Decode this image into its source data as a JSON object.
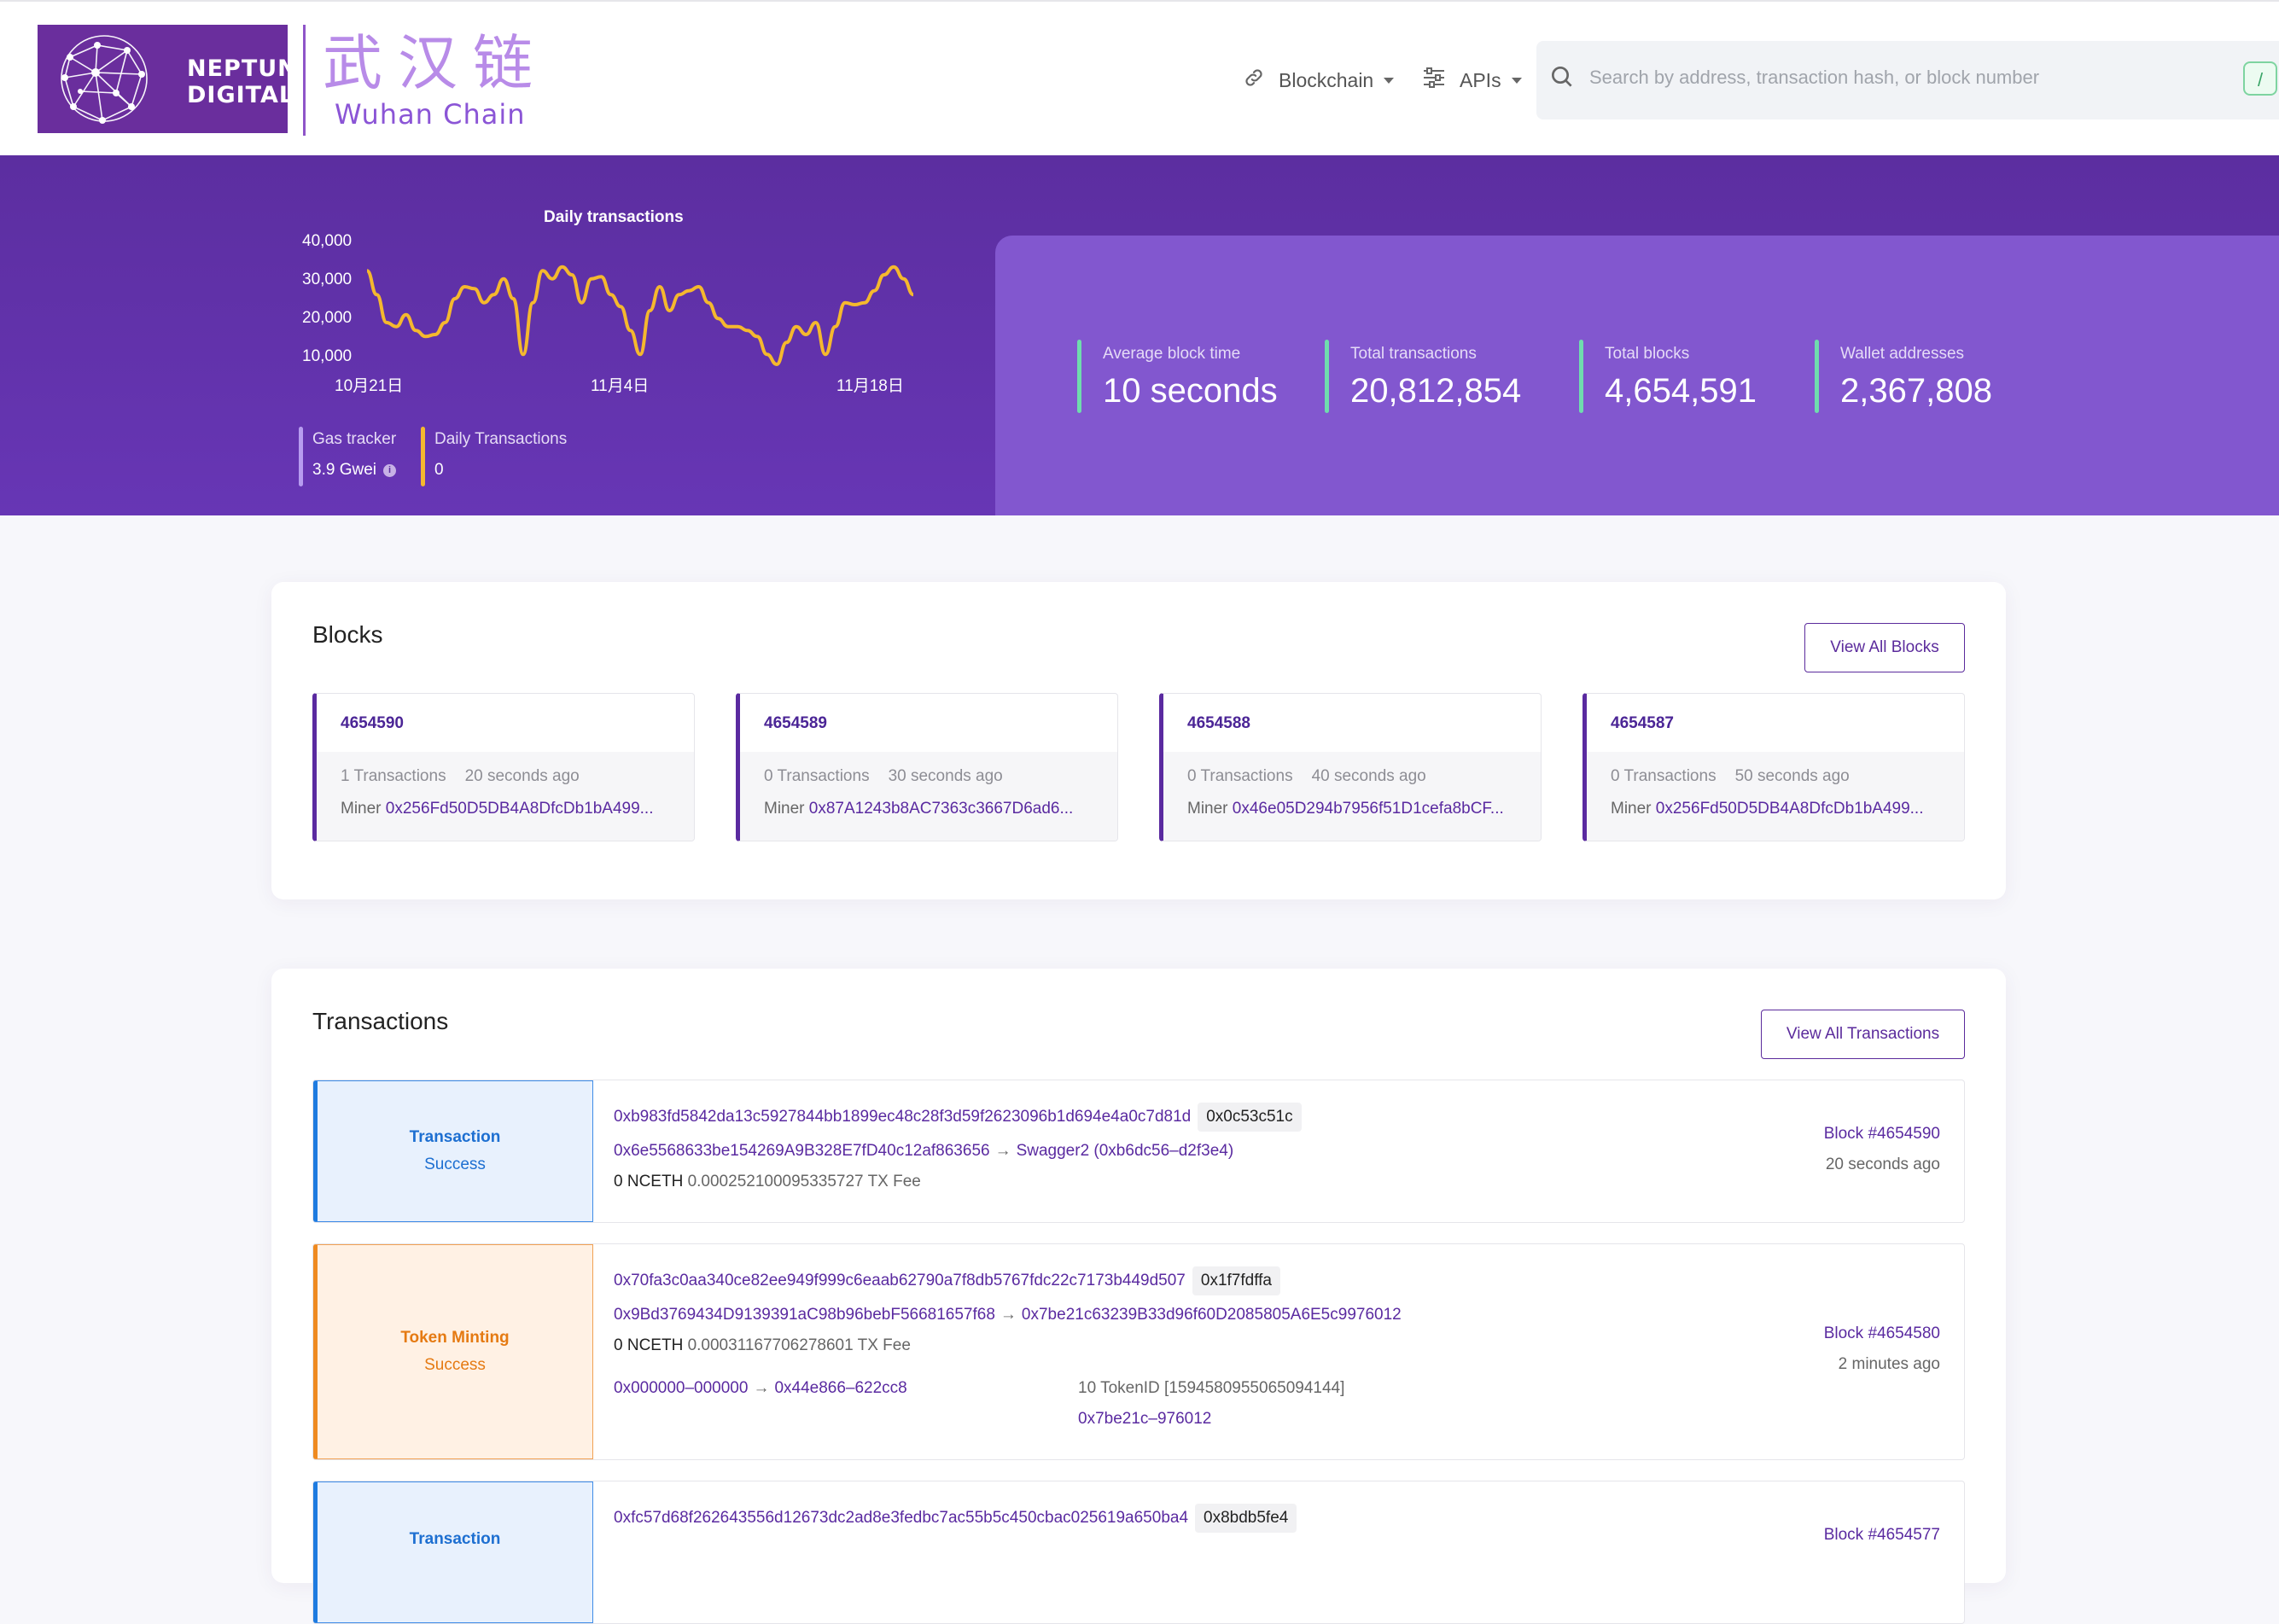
{
  "header": {
    "logo_line1": "NEPTUNE",
    "logo_line2": "DIGITAL",
    "chain_name_cn": "武汉链",
    "chain_name_en": "Wuhan Chain",
    "nav": [
      {
        "label": "Blockchain",
        "icon": "link-icon"
      },
      {
        "label": "APIs",
        "icon": "sliders-icon"
      }
    ],
    "search_placeholder": "Search by address, transaction hash, or block number",
    "search_shortcut": "/"
  },
  "hero": {
    "chart_data": {
      "type": "line",
      "title": "Daily transactions",
      "x_tick_labels": [
        "10月21日",
        "11月4日",
        "11月18日"
      ],
      "y_tick_labels": [
        "40,000",
        "30,000",
        "20,000",
        "10,000"
      ],
      "ylim": [
        10000,
        40000
      ],
      "series": [
        {
          "name": "",
          "color": "#f5b82e",
          "values": [
            35000,
            29000,
            22000,
            21000,
            24000,
            20000,
            18500,
            19000,
            22000,
            28000,
            31000,
            30500,
            27000,
            29000,
            33000,
            28000,
            14000,
            27000,
            35000,
            33000,
            36000,
            34000,
            27000,
            33000,
            33500,
            29000,
            26000,
            20000,
            14000,
            25000,
            31000,
            25000,
            29000,
            30000,
            31000,
            27000,
            23000,
            21000,
            21000,
            20000,
            18500,
            14000,
            11500,
            17000,
            21000,
            19000,
            22000,
            14000,
            21000,
            27000,
            26500,
            27000,
            30000,
            34000,
            36000,
            33000,
            29000
          ]
        }
      ]
    },
    "gas_tracker": {
      "label": "Gas tracker",
      "value": "3.9 Gwei"
    },
    "daily_transactions": {
      "label": "Daily Transactions",
      "value": "0"
    },
    "stats": [
      {
        "label": "Average block time",
        "value": "10 seconds"
      },
      {
        "label": "Total transactions",
        "value": "20,812,854"
      },
      {
        "label": "Total blocks",
        "value": "4,654,591"
      },
      {
        "label": "Wallet addresses",
        "value": "2,367,808"
      }
    ]
  },
  "blocks": {
    "title": "Blocks",
    "view_all": "View All Blocks",
    "miner_label": "Miner",
    "items": [
      {
        "number": "4654590",
        "txs": "1 Transactions",
        "age": "20 seconds ago",
        "miner": "0x256Fd50D5DB4A8DfcDb1bA499..."
      },
      {
        "number": "4654589",
        "txs": "0 Transactions",
        "age": "30 seconds ago",
        "miner": "0x87A1243b8AC7363c3667D6ad6..."
      },
      {
        "number": "4654588",
        "txs": "0 Transactions",
        "age": "40 seconds ago",
        "miner": "0x46e05D294b7956f51D1cefa8bCF..."
      },
      {
        "number": "4654587",
        "txs": "0 Transactions",
        "age": "50 seconds ago",
        "miner": "0x256Fd50D5DB4A8DfcDb1bA499..."
      }
    ]
  },
  "transactions": {
    "title": "Transactions",
    "view_all": "View All Transactions",
    "items": [
      {
        "type": "Transaction",
        "status": "Success",
        "hash": "0xb983fd5842da13c5927844bb1899ec48c28f3d59f2623096b1d694e4a0c7d81d",
        "method": "0x0c53c51c",
        "from": "0x6e5568633be154269A9B328E7fD40c12af863656",
        "arrow": "→",
        "to": "Swagger2 (0xb6dc56–d2f3e4)",
        "amount": "0 NCETH",
        "fee": "0.000252100095335727 TX Fee",
        "block": "Block #4654590",
        "age": "20 seconds ago"
      },
      {
        "type": "Token Minting",
        "status": "Success",
        "hash": "0x70fa3c0aa340ce82ee949f999c6eaab62790a7f8db5767fdc22c7173b449d507",
        "method": "0x1f7fdffa",
        "from": "0x9Bd3769434D9139391aC98b96bebF56681657f68",
        "arrow": "→",
        "to": "0x7be21c63239B33d96f60D2085805A6E5c9976012",
        "amount": "0 NCETH",
        "fee": "0.00031167706278601 TX Fee",
        "transfer_from": "0x000000–000000",
        "transfer_to": "0x44e866–622cc8",
        "token_amount": "10 TokenID [1594580955065094144]",
        "token_contract": "0x7be21c–976012",
        "block": "Block #4654580",
        "age": "2 minutes ago"
      },
      {
        "type": "Transaction",
        "status": "",
        "hash": "0xfc57d68f262643556d12673dc2ad8e3fedbc7ac55b5c450cbac025619a650ba4",
        "method": "0x8bdb5fe4",
        "block": "Block #4654577"
      }
    ]
  }
}
